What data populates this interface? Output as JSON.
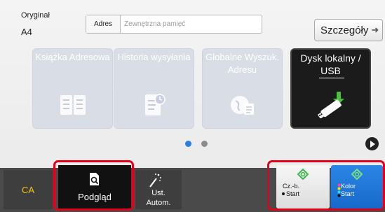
{
  "original": {
    "label": "Oryginał",
    "size": "A4"
  },
  "address": {
    "tag": "Adres",
    "placeholder": "Zewnętrzna pamięć"
  },
  "details_button": {
    "label": "Szczegóły"
  },
  "tiles": [
    {
      "label": "Książka Adresowa",
      "enabled": false,
      "icon": "address-book-icon"
    },
    {
      "label": "Historia wysyłania",
      "enabled": false,
      "icon": "send-history-icon"
    },
    {
      "label": "Globalne Wyszuk. Adresu",
      "enabled": false,
      "icon": "global-search-icon"
    },
    {
      "label_line1": "Dysk lokalny /",
      "label_line2": "USB",
      "enabled": true,
      "icon": "usb-drive-icon"
    }
  ],
  "pager": {
    "pages": 2,
    "current": 1
  },
  "bottom_bar": {
    "ca": "CA",
    "preview": "Podgląd",
    "auto_line1": "Ust.",
    "auto_line2": "Autom.",
    "bw_line1": "Cz.-b.",
    "bw_line2": "Start",
    "color_line1": "Kolor",
    "color_line2": "Start"
  },
  "colors": {
    "highlight": "#e2001a",
    "ca_text": "#f5c400",
    "pager_active": "#2a7de1",
    "start_green": "#3bb54a",
    "color_start_bg": "#1f77d8"
  }
}
